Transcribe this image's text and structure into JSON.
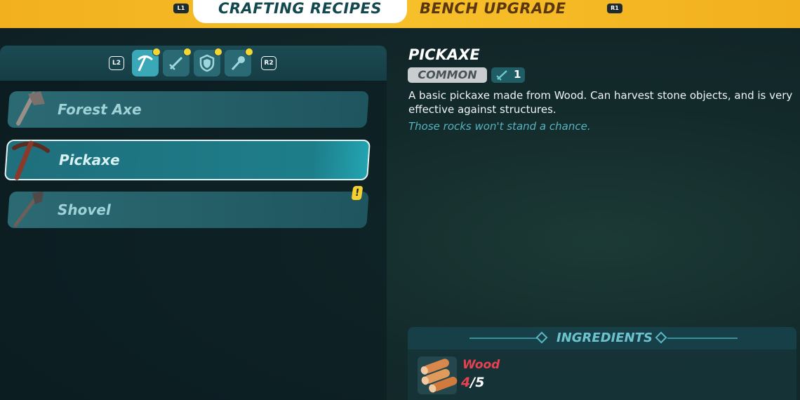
{
  "header": {
    "left_hint": "L1",
    "right_hint": "R1",
    "tabs": [
      {
        "label": "CRAFTING RECIPES",
        "active": true
      },
      {
        "label": "BENCH UPGRADE",
        "active": false
      }
    ]
  },
  "categories": {
    "left_hint": "L2",
    "right_hint": "R2",
    "items": [
      {
        "icon": "pickaxe-icon",
        "selected": true,
        "has_new": true
      },
      {
        "icon": "sword-icon",
        "selected": false,
        "has_new": true
      },
      {
        "icon": "shield-icon",
        "selected": false,
        "has_new": true
      },
      {
        "icon": "torch-icon",
        "selected": false,
        "has_new": true
      }
    ]
  },
  "recipes": [
    {
      "label": "Forest Axe",
      "icon": "axe-icon",
      "selected": false,
      "new": false
    },
    {
      "label": "Pickaxe",
      "icon": "pickaxe-icon",
      "selected": true,
      "new": false
    },
    {
      "label": "Shovel",
      "icon": "shovel-icon",
      "selected": false,
      "new": true,
      "badge": "!"
    }
  ],
  "detail": {
    "title": "PICKAXE",
    "rarity": "COMMON",
    "level": "1",
    "description": "A basic pickaxe made from Wood. Can harvest stone objects, and is very effective against structures.",
    "flavor": "Those rocks won't stand a chance.",
    "ingredients_title": "INGREDIENTS",
    "ingredients": [
      {
        "name": "Wood",
        "have": "4",
        "separator": "/",
        "need": "5",
        "icon": "wood-logs-icon"
      }
    ]
  },
  "colors": {
    "accent_gold": "#f7c02a",
    "teal": "#1f6f7c",
    "insufficient_red": "#e7414f",
    "rarity_common": "#c9cdcf"
  }
}
